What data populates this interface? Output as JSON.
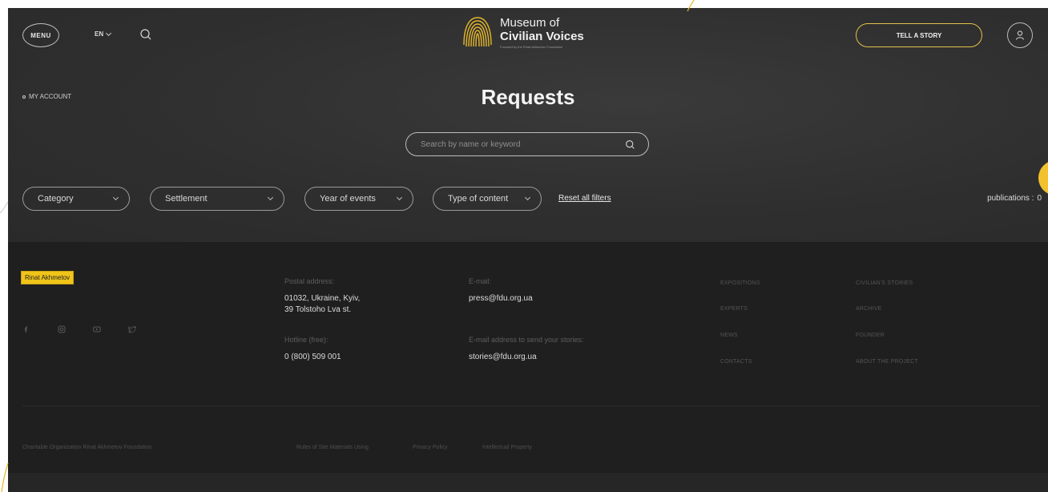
{
  "header": {
    "menu_label": "MENU",
    "language": "EN",
    "logo_line1": "Museum of",
    "logo_line2": "Civilian Voices",
    "logo_tagline": "Founded by the Rinat Akhmetov Foundation",
    "cta_label": "TELL A STORY"
  },
  "breadcrumb": {
    "label": "MY ACCOUNT"
  },
  "page": {
    "title": "Requests"
  },
  "search": {
    "placeholder": "Search by name or keyword"
  },
  "filters": {
    "items": [
      {
        "label": "Category"
      },
      {
        "label": "Settlement"
      },
      {
        "label": "Year of events"
      },
      {
        "label": "Type of content"
      }
    ],
    "reset_label": "Reset all filters",
    "publications_label": "publications :",
    "publications_count": "0"
  },
  "footer": {
    "founder_badge": "Rinat Akhmetov",
    "postal_label": "Postal address:",
    "postal_line1": "01032, Ukraine, Kyiv,",
    "postal_line2": "39 Tolstoho Lva st.",
    "hotline_label": "Hotline (free):",
    "hotline_value": "0 (800) 509 001",
    "email_label": "E-mail:",
    "email_value": "press@fdu.org.ua",
    "stories_label": "E-mail address to send your stories:",
    "stories_value": "stories@fdu.org.ua",
    "nav_col1": [
      "EXPOSITIONS",
      "EXPERTS",
      "NEWS",
      "CONTACTS"
    ],
    "nav_col2": [
      "CIVILIAN'S STORIES",
      "ARCHIVE",
      "FOUNDER",
      "ABOUT THE PROJECT"
    ],
    "copyright": "Charitable Organization Rinat Akhmetov Foundation",
    "legal_links": [
      "Rules of Site Materials Using",
      "Privacy Policy",
      "Intellectual Property"
    ],
    "social_icons": [
      "facebook-icon",
      "instagram-icon",
      "youtube-icon",
      "twitter-icon"
    ]
  },
  "colors": {
    "accent": "#e4c04a",
    "badge": "#f0c419",
    "background": "#2e2e2e",
    "footer": "#1f1f1f"
  }
}
